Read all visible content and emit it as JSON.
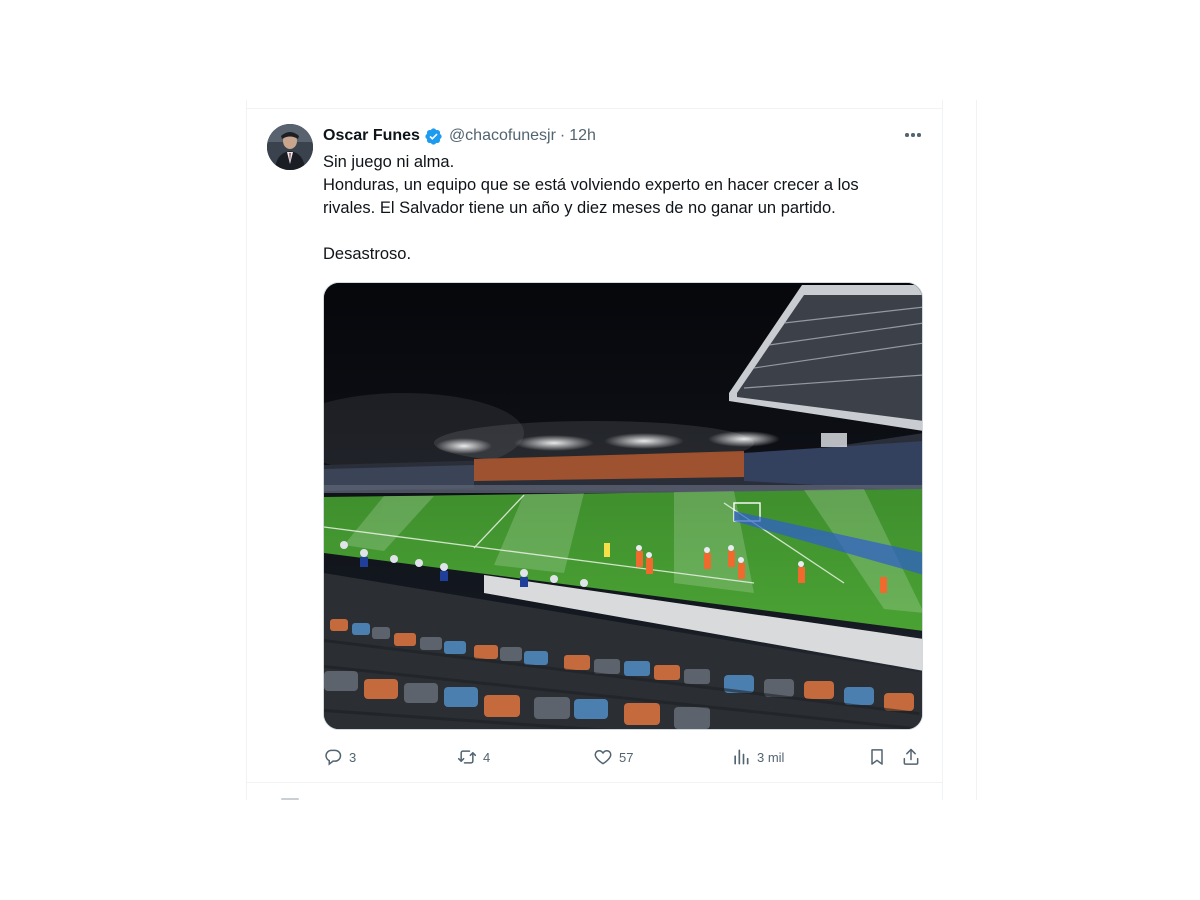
{
  "tweet": {
    "author": {
      "display_name": "Oscar Funes",
      "handle": "@chacofunesjr",
      "verified": true
    },
    "separator": "·",
    "time": "12h",
    "text_lines": [
      "Sin juego ni alma.",
      "Honduras, un equipo que se está volviendo experto en hacer crecer a los",
      "rivales. El Salvador tiene un año y diez meses de no ganar un partido.",
      "",
      "Desastroso."
    ],
    "media": {
      "kind": "photo"
    },
    "actions": {
      "replies": "3",
      "reposts": "4",
      "likes": "57",
      "views": "3 mil"
    }
  },
  "colors": {
    "text_primary": "#0f1419",
    "text_secondary": "#536471",
    "verified_blue": "#1d9bf0",
    "border": "#eff3f4"
  },
  "icons": {
    "verified": "verified-badge-icon",
    "more": "more-dots-icon",
    "reply": "reply-bubble-icon",
    "repost": "repost-arrows-icon",
    "like": "heart-icon",
    "views": "views-bar-chart-icon",
    "bookmark": "bookmark-icon",
    "share": "share-upload-icon"
  }
}
